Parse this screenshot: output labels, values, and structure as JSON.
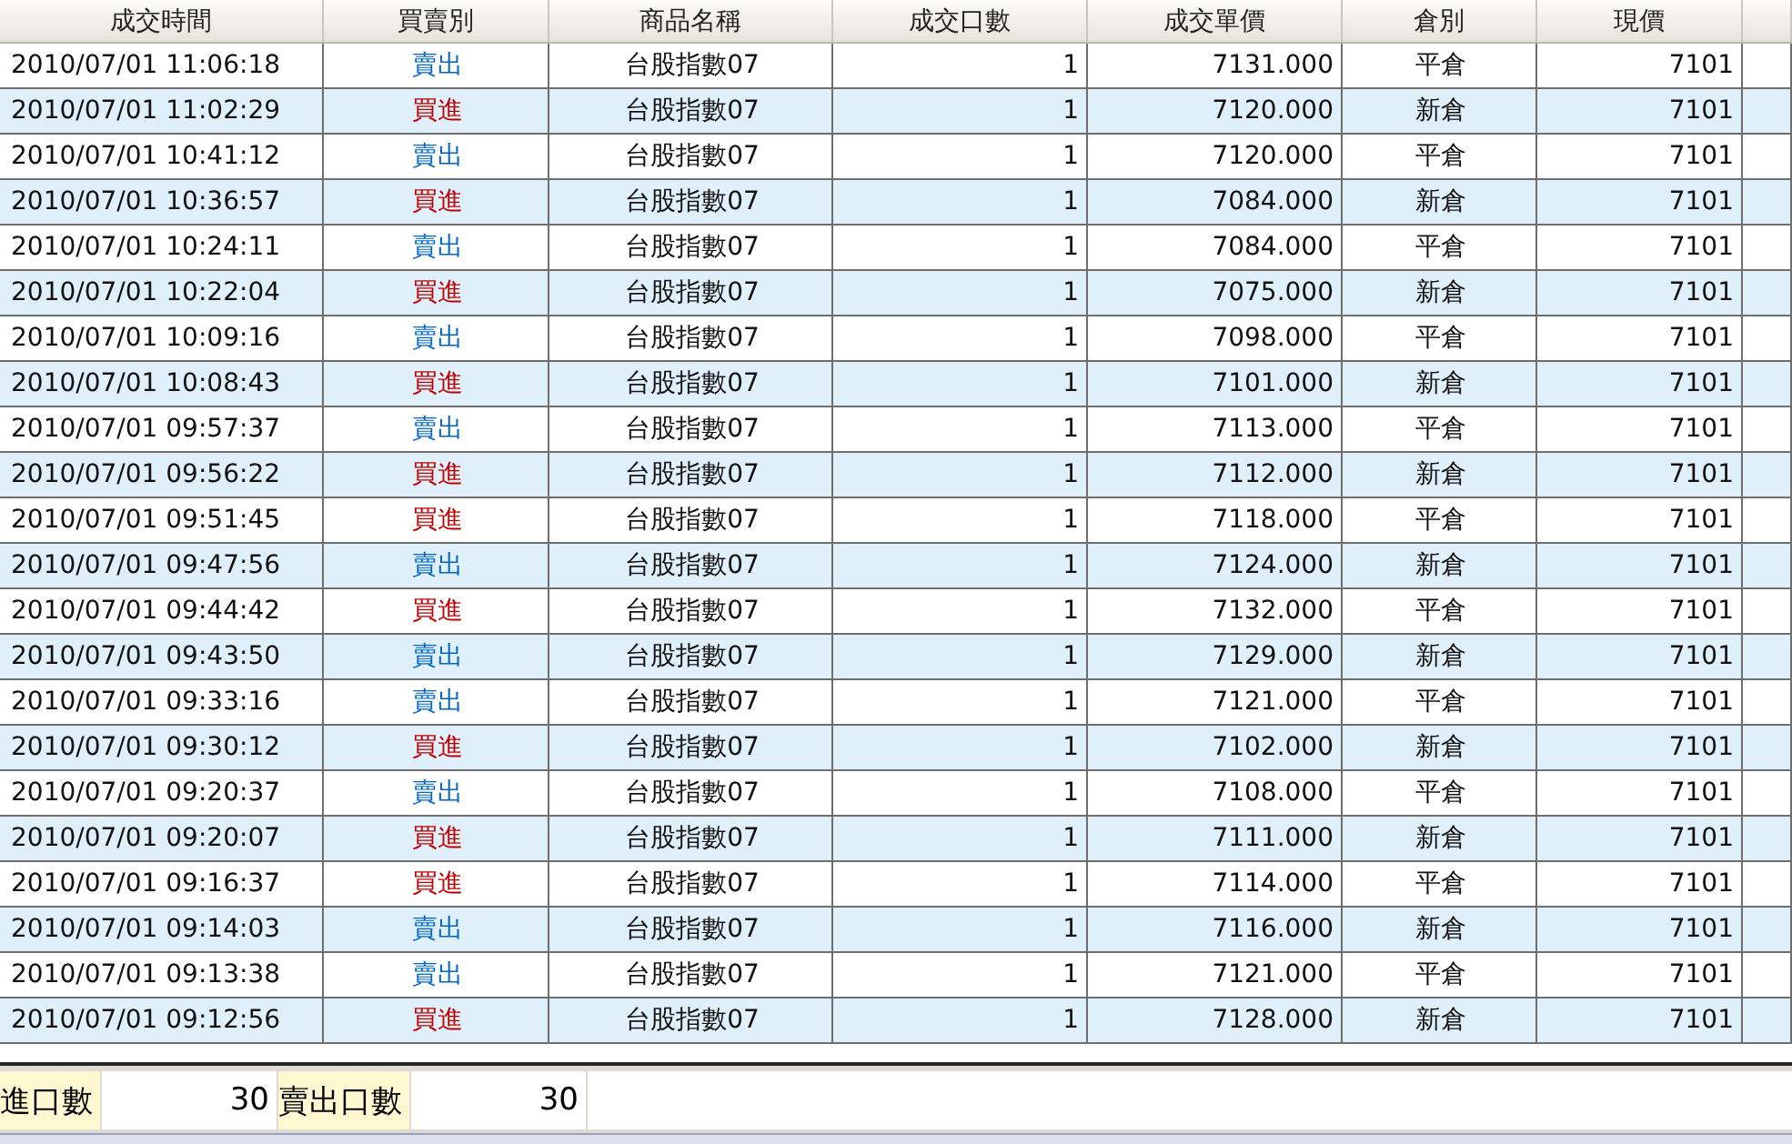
{
  "table": {
    "columns": [
      "成交時間",
      "買賣別",
      "商品名稱",
      "成交口數",
      "成交單價",
      "倉別",
      "現價"
    ],
    "rows": [
      {
        "time": "2010/07/01 11:06:18",
        "side": "賣出",
        "kind": "sell",
        "product": "台股指數07",
        "qty": "1",
        "price": "7131.000",
        "position": "平倉",
        "current": "7101"
      },
      {
        "time": "2010/07/01 11:02:29",
        "side": "買進",
        "kind": "buy",
        "product": "台股指數07",
        "qty": "1",
        "price": "7120.000",
        "position": "新倉",
        "current": "7101"
      },
      {
        "time": "2010/07/01 10:41:12",
        "side": "賣出",
        "kind": "sell",
        "product": "台股指數07",
        "qty": "1",
        "price": "7120.000",
        "position": "平倉",
        "current": "7101"
      },
      {
        "time": "2010/07/01 10:36:57",
        "side": "買進",
        "kind": "buy",
        "product": "台股指數07",
        "qty": "1",
        "price": "7084.000",
        "position": "新倉",
        "current": "7101"
      },
      {
        "time": "2010/07/01 10:24:11",
        "side": "賣出",
        "kind": "sell",
        "product": "台股指數07",
        "qty": "1",
        "price": "7084.000",
        "position": "平倉",
        "current": "7101"
      },
      {
        "time": "2010/07/01 10:22:04",
        "side": "買進",
        "kind": "buy",
        "product": "台股指數07",
        "qty": "1",
        "price": "7075.000",
        "position": "新倉",
        "current": "7101"
      },
      {
        "time": "2010/07/01 10:09:16",
        "side": "賣出",
        "kind": "sell",
        "product": "台股指數07",
        "qty": "1",
        "price": "7098.000",
        "position": "平倉",
        "current": "7101"
      },
      {
        "time": "2010/07/01 10:08:43",
        "side": "買進",
        "kind": "buy",
        "product": "台股指數07",
        "qty": "1",
        "price": "7101.000",
        "position": "新倉",
        "current": "7101"
      },
      {
        "time": "2010/07/01 09:57:37",
        "side": "賣出",
        "kind": "sell",
        "product": "台股指數07",
        "qty": "1",
        "price": "7113.000",
        "position": "平倉",
        "current": "7101"
      },
      {
        "time": "2010/07/01 09:56:22",
        "side": "買進",
        "kind": "buy",
        "product": "台股指數07",
        "qty": "1",
        "price": "7112.000",
        "position": "新倉",
        "current": "7101"
      },
      {
        "time": "2010/07/01 09:51:45",
        "side": "買進",
        "kind": "buy",
        "product": "台股指數07",
        "qty": "1",
        "price": "7118.000",
        "position": "平倉",
        "current": "7101"
      },
      {
        "time": "2010/07/01 09:47:56",
        "side": "賣出",
        "kind": "sell",
        "product": "台股指數07",
        "qty": "1",
        "price": "7124.000",
        "position": "新倉",
        "current": "7101"
      },
      {
        "time": "2010/07/01 09:44:42",
        "side": "買進",
        "kind": "buy",
        "product": "台股指數07",
        "qty": "1",
        "price": "7132.000",
        "position": "平倉",
        "current": "7101"
      },
      {
        "time": "2010/07/01 09:43:50",
        "side": "賣出",
        "kind": "sell",
        "product": "台股指數07",
        "qty": "1",
        "price": "7129.000",
        "position": "新倉",
        "current": "7101"
      },
      {
        "time": "2010/07/01 09:33:16",
        "side": "賣出",
        "kind": "sell",
        "product": "台股指數07",
        "qty": "1",
        "price": "7121.000",
        "position": "平倉",
        "current": "7101"
      },
      {
        "time": "2010/07/01 09:30:12",
        "side": "買進",
        "kind": "buy",
        "product": "台股指數07",
        "qty": "1",
        "price": "7102.000",
        "position": "新倉",
        "current": "7101"
      },
      {
        "time": "2010/07/01 09:20:37",
        "side": "賣出",
        "kind": "sell",
        "product": "台股指數07",
        "qty": "1",
        "price": "7108.000",
        "position": "平倉",
        "current": "7101"
      },
      {
        "time": "2010/07/01 09:20:07",
        "side": "買進",
        "kind": "buy",
        "product": "台股指數07",
        "qty": "1",
        "price": "7111.000",
        "position": "新倉",
        "current": "7101"
      },
      {
        "time": "2010/07/01 09:16:37",
        "side": "買進",
        "kind": "buy",
        "product": "台股指數07",
        "qty": "1",
        "price": "7114.000",
        "position": "平倉",
        "current": "7101"
      },
      {
        "time": "2010/07/01 09:14:03",
        "side": "賣出",
        "kind": "sell",
        "product": "台股指數07",
        "qty": "1",
        "price": "7116.000",
        "position": "新倉",
        "current": "7101"
      },
      {
        "time": "2010/07/01 09:13:38",
        "side": "賣出",
        "kind": "sell",
        "product": "台股指數07",
        "qty": "1",
        "price": "7121.000",
        "position": "平倉",
        "current": "7101"
      },
      {
        "time": "2010/07/01 09:12:56",
        "side": "買進",
        "kind": "buy",
        "product": "台股指數07",
        "qty": "1",
        "price": "7128.000",
        "position": "新倉",
        "current": "7101"
      }
    ]
  },
  "summary": [
    {
      "label": "進口數",
      "value": "30"
    },
    {
      "label": "賣出口數",
      "value": "30"
    }
  ]
}
